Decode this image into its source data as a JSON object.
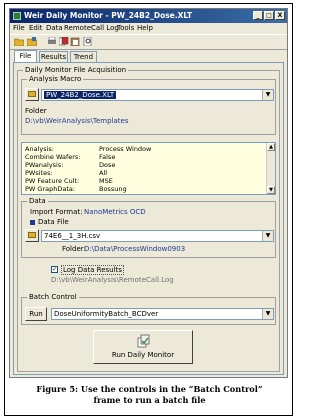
{
  "window": {
    "title": "Weir Daily Monitor - PW_24B2_Dose.XLT",
    "controls": {
      "minimize": "_",
      "maximize": "□",
      "close": "X"
    }
  },
  "menu": [
    "File",
    "Edit",
    "Data",
    "RemoteCall Log",
    "Tools",
    "Help"
  ],
  "toolbar_icons": [
    "open-folder-icon",
    "open-icon",
    "print-icon",
    "copy-icon",
    "paste-icon",
    "preview-icon"
  ],
  "tabs": [
    "File",
    "Results",
    "Trend"
  ],
  "active_tab": "File",
  "acquisition": {
    "title": "Daily Monitor File Acquisition",
    "analysis_macro": {
      "label": "Analysis Macro",
      "selected": "PW_24B2_Dose.XLT",
      "folder_label": "Folder",
      "folder_path": "D:\\vb\\WeirAnalysis\\Templates"
    },
    "properties": [
      {
        "key": "Analysis:",
        "value": "Process Window"
      },
      {
        "key": "Combine Wafers:",
        "value": "False"
      },
      {
        "key": "PWanalysis:",
        "value": "Dose"
      },
      {
        "key": "PWsites:",
        "value": "All"
      },
      {
        "key": "PW Feature Cult:",
        "value": "MSE"
      },
      {
        "key": "PW GraphData:",
        "value": "Bossung"
      }
    ],
    "data": {
      "label": "Data",
      "import_format_label": "Import Format:",
      "import_format_value": "NanoMetrics OCD",
      "data_file_label": "Data File",
      "data_file": "74E6__1_3H.csv",
      "folder_label": "Folder:",
      "folder_path": "D:\\Data\\ProcessWindow0903"
    },
    "log": {
      "label": "Log Data Results",
      "checked": true,
      "path": "D:\\vb\\WeirAnalysis\\RemoteCall.Log"
    },
    "batch": {
      "label": "Batch Control",
      "run_label": "Run",
      "selected": "DoseUniformityBatch_BCDver"
    },
    "run_daily_label": "Run Daily Monitor"
  },
  "caption": {
    "line1": "Figure 5: Use the controls in the “Batch Control”",
    "line2": "frame to run a batch file"
  }
}
